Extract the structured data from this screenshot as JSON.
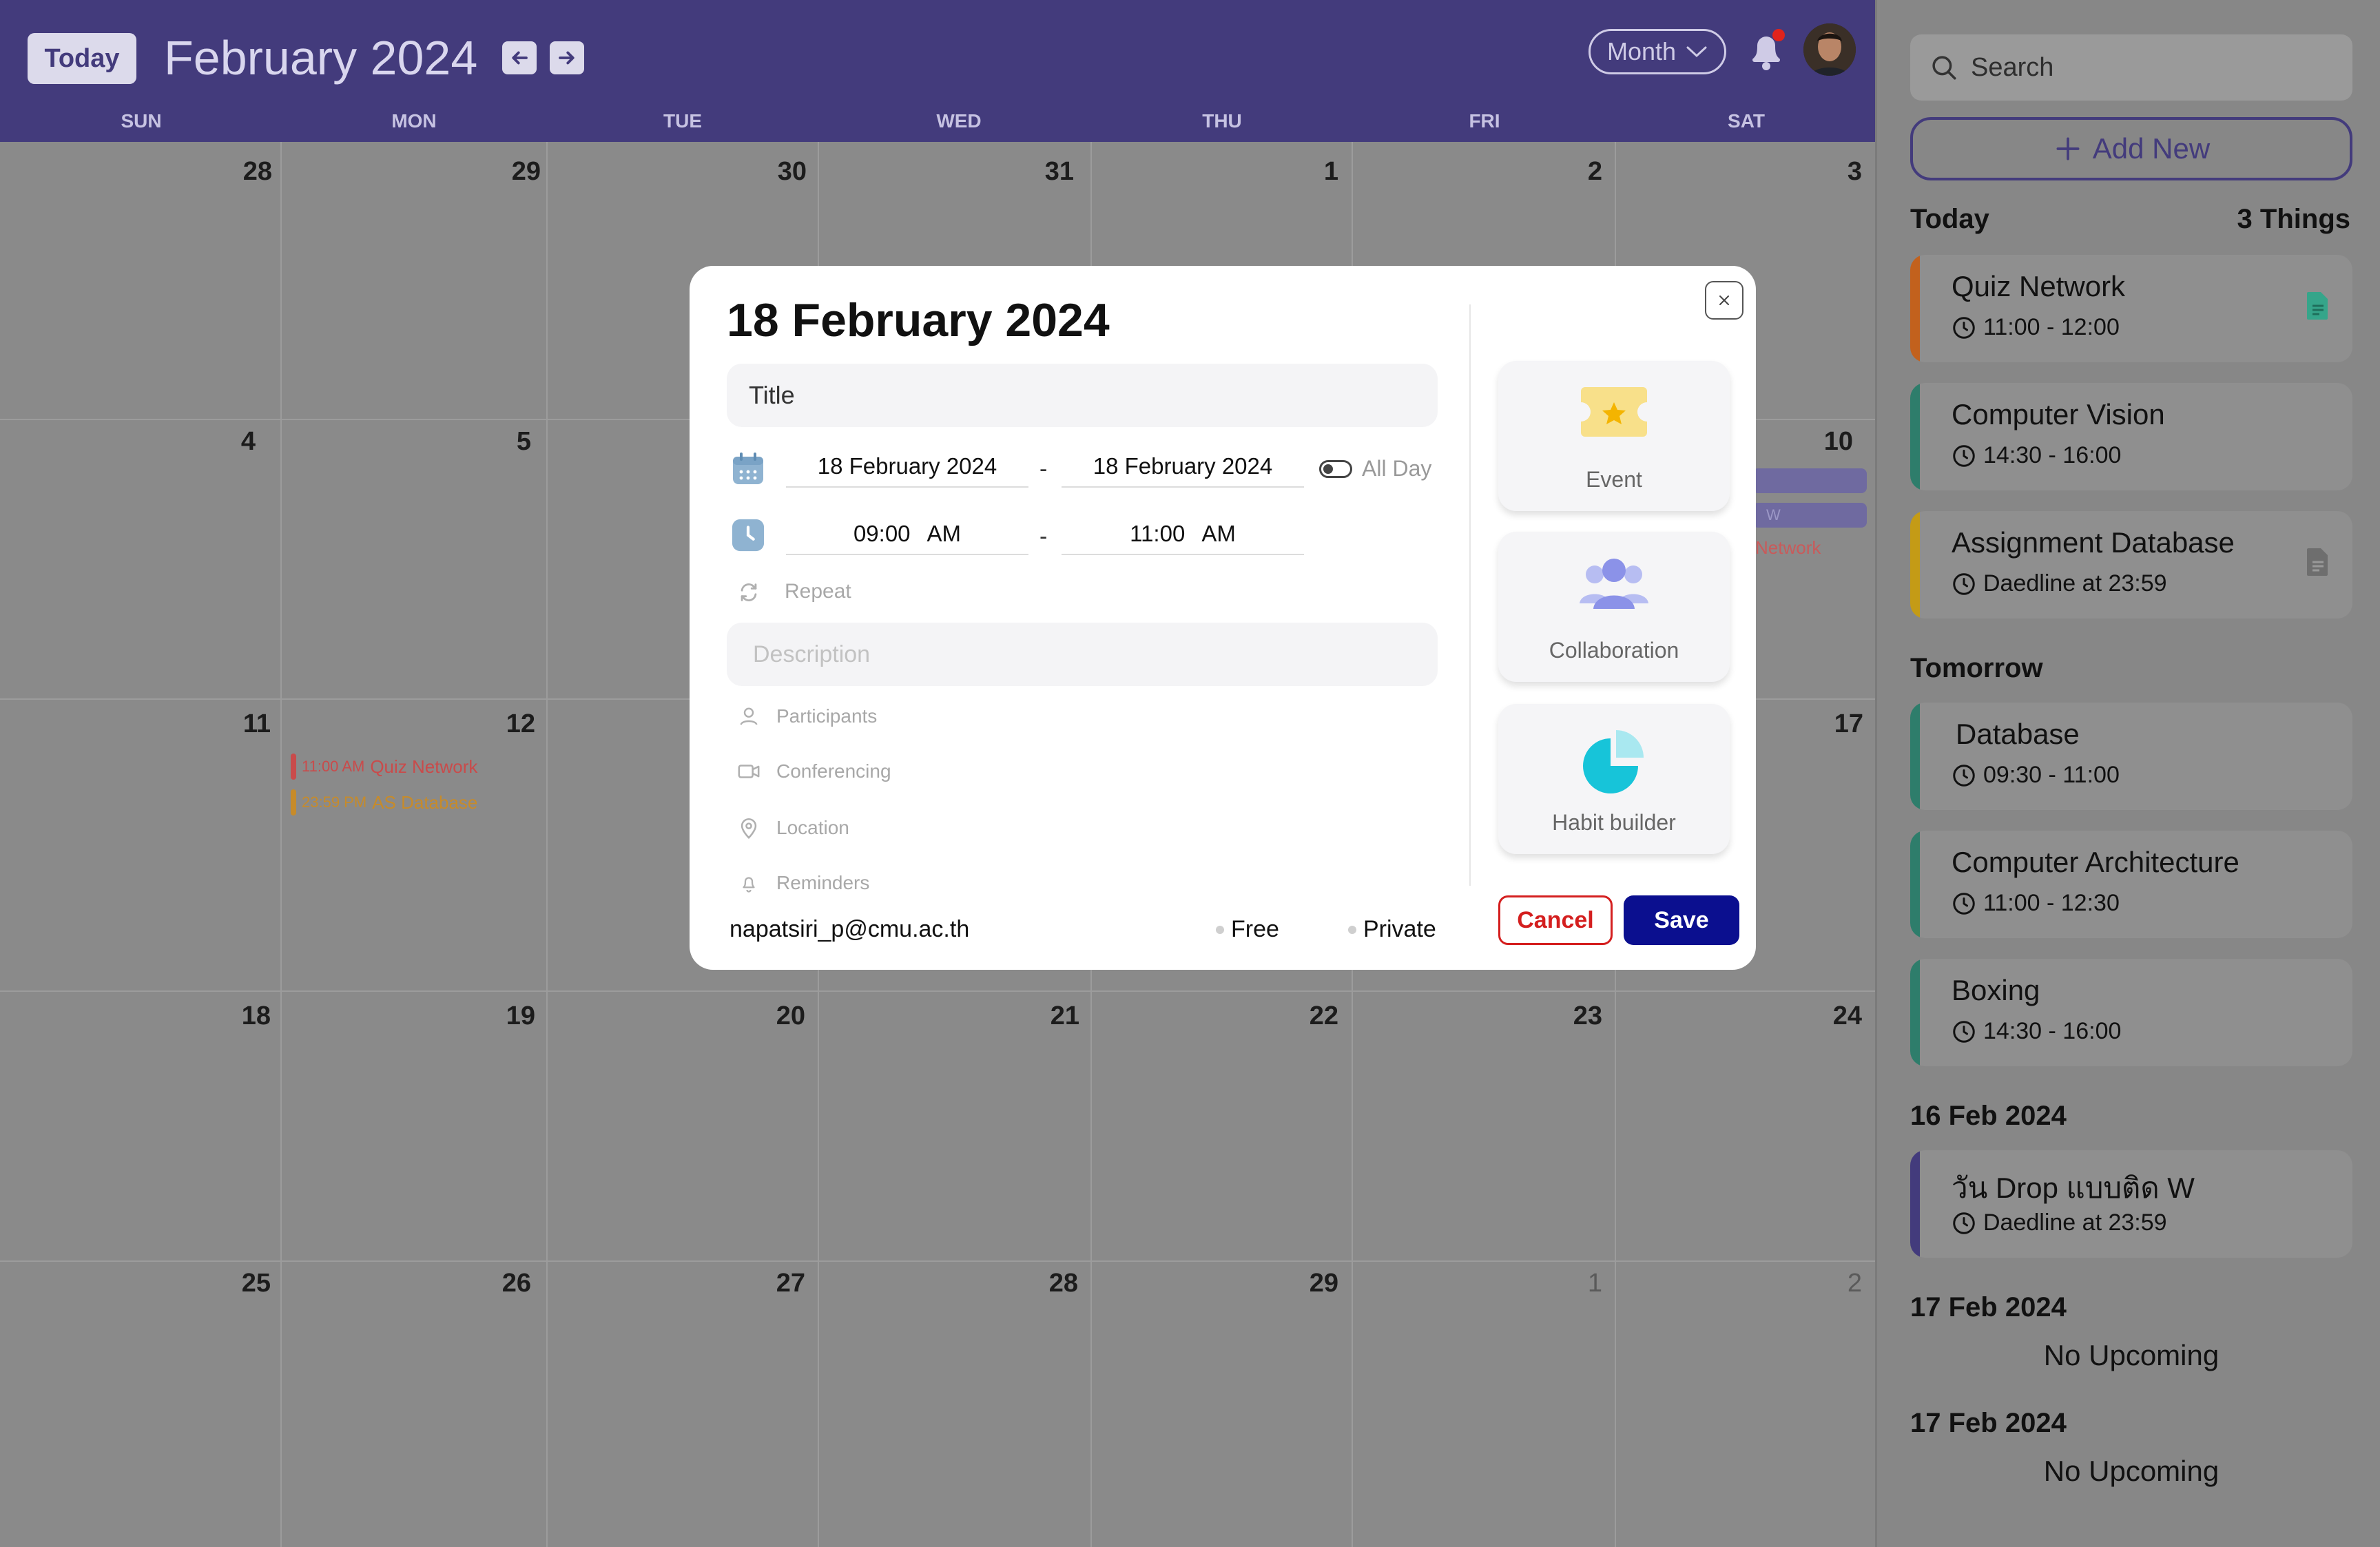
{
  "header": {
    "today_label": "Today",
    "month_title": "February 2024",
    "view_label": "Month"
  },
  "weekdays": [
    "SUN",
    "MON",
    "TUE",
    "WED",
    "THU",
    "FRI",
    "SAT"
  ],
  "weeks": [
    [
      "28",
      "29",
      "30",
      "31",
      "1",
      "2",
      "3"
    ],
    [
      "4",
      "5",
      "",
      "",
      "",
      "",
      "10"
    ],
    [
      "11",
      "12",
      "",
      "",
      "",
      "",
      "17"
    ],
    [
      "18",
      "19",
      "20",
      "21",
      "22",
      "23",
      "24"
    ],
    [
      "25",
      "26",
      "27",
      "28",
      "29",
      "1",
      "2"
    ]
  ],
  "grid_events": [
    {
      "time": "11:00 AM",
      "title": "Quiz Network",
      "color": "#c94b4b"
    },
    {
      "time": "23:59 PM",
      "title": "AS Database",
      "color": "#c78b2a"
    }
  ],
  "partial_events": {
    "w_label": "W",
    "network_label": "Network"
  },
  "sidebar": {
    "search_placeholder": "Search",
    "add_new_label": "Add New",
    "today_heading": "Today",
    "today_count": "3 Things",
    "tomorrow_heading": "Tomorrow",
    "today_items": [
      {
        "name": "Quiz Network",
        "time": "11:00 - 12:00",
        "accent": "#c2611d",
        "doc": "doc-green-icon"
      },
      {
        "name": "Computer Vision",
        "time": "14:30 - 16:00",
        "accent": "#2e7d6b"
      },
      {
        "name": "Assignment Database",
        "time": "Daedline at 23:59",
        "accent": "#c49b16",
        "doc": "doc-gray-icon"
      }
    ],
    "tomorrow_items": [
      {
        "name": "Database",
        "time": "09:30 - 11:00",
        "accent": "#2e7d6b"
      },
      {
        "name": "Computer Architecture",
        "time": "11:00 - 12:30",
        "accent": "#2e7d6b"
      },
      {
        "name": "Boxing",
        "time": "14:30 - 16:00",
        "accent": "#2e7d6b"
      }
    ],
    "feb16_heading": "16 Feb 2024",
    "feb16_item": {
      "name": "วัน Drop แบบติด W",
      "time": "Daedline at 23:59",
      "accent": "#433b7c"
    },
    "feb17a_heading": "17 Feb 2024",
    "feb17a_empty": "No Upcoming",
    "feb17b_heading": "17 Feb 2024",
    "feb17b_empty": "No Upcoming"
  },
  "modal": {
    "date_title": "18 February 2024",
    "title_placeholder": "Title",
    "start_date": "18 February 2024",
    "end_date": "18 February 2024",
    "dash": "-",
    "all_day_label": "All Day",
    "start_time": "09:00",
    "start_ampm": "AM",
    "end_time": "11:00",
    "end_ampm": "AM",
    "repeat_label": "Repeat",
    "description_placeholder": "Description",
    "participants_label": "Participants",
    "conferencing_label": "Conferencing",
    "location_label": "Location",
    "reminders_label": "Reminders",
    "email": "napatsiri_p@cmu.ac.th",
    "free_label": "Free",
    "private_label": "Private",
    "types": [
      {
        "label": "Event",
        "icon": "ticket-star-icon"
      },
      {
        "label": "Collaboration",
        "icon": "group-icon"
      },
      {
        "label": "Habit builder",
        "icon": "pie-chart-icon"
      }
    ],
    "cancel_label": "Cancel",
    "save_label": "Save"
  },
  "colors": {
    "header_bg": "#433b7c",
    "save_bg": "#0b0f8f",
    "cancel": "#d41f1f",
    "notification_dot": "#e0231c"
  }
}
